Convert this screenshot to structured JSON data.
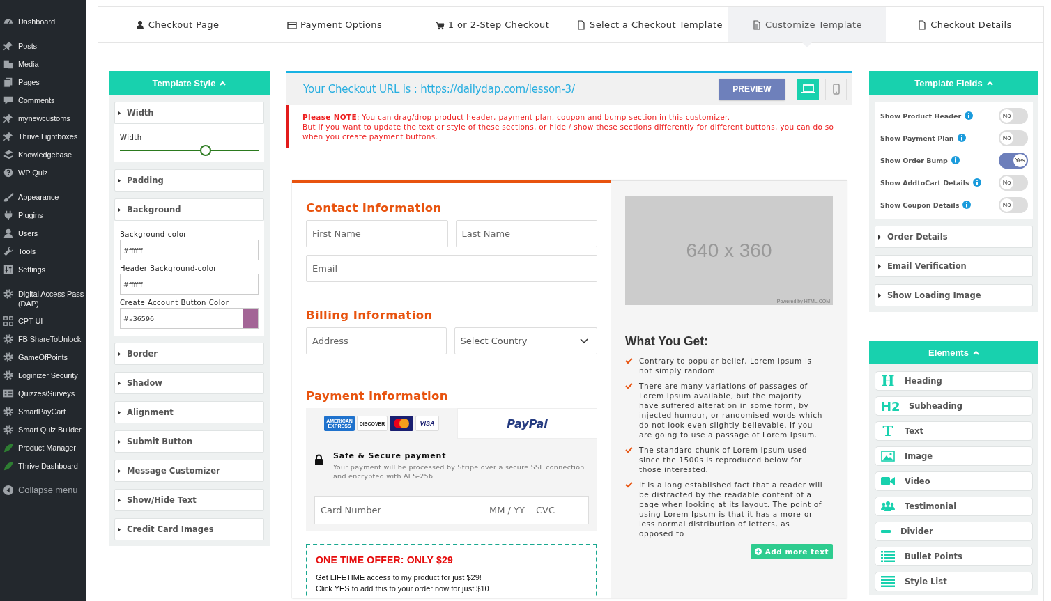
{
  "admin_menu": {
    "groups": [
      {
        "items": [
          {
            "label": "Dashboard"
          }
        ]
      },
      {
        "items": [
          {
            "label": "Posts"
          },
          {
            "label": "Media"
          },
          {
            "label": "Pages"
          },
          {
            "label": "Comments"
          },
          {
            "label": "mynewcustoms"
          },
          {
            "label": "Thrive Lightboxes"
          },
          {
            "label": "Knowledgebase"
          },
          {
            "label": "WP Quiz"
          }
        ]
      },
      {
        "items": [
          {
            "label": "Appearance"
          },
          {
            "label": "Plugins"
          },
          {
            "label": "Users"
          },
          {
            "label": "Tools"
          },
          {
            "label": "Settings"
          }
        ]
      },
      {
        "items": [
          {
            "label": "Digital Access Pass (DAP)"
          },
          {
            "label": "CPT UI"
          },
          {
            "label": "FB ShareToUnlock"
          },
          {
            "label": "GameOfPoints"
          },
          {
            "label": "Loginizer Security"
          },
          {
            "label": "Quizzes/Surveys"
          },
          {
            "label": "SmartPayCart"
          },
          {
            "label": "Smart Quiz Builder"
          },
          {
            "label": "Product Manager"
          },
          {
            "label": "Thrive Dashboard"
          }
        ]
      }
    ],
    "collapse": "Collapse menu"
  },
  "tabs": [
    {
      "label": "Checkout Page",
      "selected": false
    },
    {
      "label": "Payment Options",
      "selected": false
    },
    {
      "label": "1 or 2-Step Checkout",
      "selected": false
    },
    {
      "label": "Select a Checkout Template",
      "selected": false
    },
    {
      "label": "Customize Template",
      "selected": true
    },
    {
      "label": "Checkout Details",
      "selected": false
    }
  ],
  "template_style": {
    "title": "Template Style",
    "expanded": true,
    "sections": [
      {
        "label": "Width",
        "kind": "slider",
        "field_label": "Width",
        "level": 0.62
      },
      {
        "label": "Padding",
        "kind": "plain"
      },
      {
        "label": "Background",
        "kind": "colors",
        "fields": [
          {
            "label": "Background-color",
            "value": "#ffffff",
            "color": "#ffffff"
          },
          {
            "label": "Header Background-color",
            "value": "#ffffff",
            "color": "#ffffff"
          },
          {
            "label": "Create Account Button Color",
            "value": "#a36596",
            "color": "#a36596"
          }
        ]
      },
      {
        "label": "Border",
        "kind": "plain"
      },
      {
        "label": "Shadow",
        "kind": "plain"
      },
      {
        "label": "Alignment",
        "kind": "plain"
      },
      {
        "label": "Submit Button",
        "kind": "plain"
      },
      {
        "label": "Message Customizer",
        "kind": "plain"
      },
      {
        "label": "Show/Hide Text",
        "kind": "plain"
      },
      {
        "label": "Credit Card Images",
        "kind": "plain"
      }
    ]
  },
  "checkout_url": "Your Checkout URL is : https://dailydap.com/lesson-3/",
  "preview_button": "PREVIEW",
  "devices": [
    {
      "kind": "desktop",
      "selected": true
    },
    {
      "kind": "mobile",
      "selected": false
    }
  ],
  "note": [
    "**Please NOTE**: You can drag/drop product header, payment plan, coupon and bump section in this customizer.",
    "But if you want to update the text or style of these sections, or hide / show these sections differently for different buttons, you can do so when you create payment buttons."
  ],
  "form": {
    "contact": {
      "heading": "Contact Information",
      "first_name": {
        "placeholder": "First Name"
      },
      "last_name": {
        "placeholder": "Last Name"
      },
      "email": {
        "placeholder": "Email"
      }
    },
    "billing": {
      "heading": "Billing Information",
      "address": {
        "placeholder": "Address"
      },
      "country": {
        "placeholder": "Select Country"
      }
    },
    "payment": {
      "heading": "Payment Information",
      "cards": [
        {
          "kind": "amex",
          "label": "AMERICAN EXPRESS"
        },
        {
          "kind": "discover",
          "label": "DISCOVER"
        },
        {
          "kind": "mastercard"
        },
        {
          "kind": "visa",
          "label": "VISA"
        }
      ],
      "paypal": "PayPal",
      "secure_title": "Safe & Secure payment",
      "secure_text": "Your payment will be processed by Stripe over a secure SSL connection and encrypted with AES-256.",
      "card_number": {
        "placeholder": "Card Number"
      },
      "expiry": {
        "placeholder": "MM / YY"
      },
      "cvc": {
        "placeholder": "CVC"
      }
    },
    "offer": {
      "title": "ONE TIME OFFER: ONLY $29",
      "lines": [
        "Get LIFETIME access to my product for just $29!",
        "Click YES to add this to your order now for just $10"
      ]
    },
    "image_placeholder": {
      "size": "640 x 360",
      "credit": "Powered by HTML.COM"
    },
    "benefits_title": "What You Get:",
    "benefits": [
      "Contrary to popular belief, Lorem Ipsum is not simply random",
      "There are many variations of passages of Lorem Ipsum available, but the majority have suffered alteration in some form, by injected humour, or randomised words which do not look even slightly believable. If you are going to use a passage of Lorem Ipsum.",
      "The standard chunk of Lorem Ipsum used since the 1500s is reproduced below for those interested.",
      "It is a long established fact that a reader will be distracted by the readable content of a page when looking at its layout. The point of using Lorem Ipsum is that it has a more-or-less normal distribution of letters, as opposed to"
    ],
    "add_text_button": "Add more text"
  },
  "template_fields": {
    "title": "Template Fields",
    "expanded": true,
    "toggles": [
      {
        "label": "Show Product Header",
        "on": false,
        "state": "No"
      },
      {
        "label": "Show Payment Plan",
        "on": false,
        "state": "No"
      },
      {
        "label": "Show Order Bump",
        "on": true,
        "state": "Yes"
      },
      {
        "label": "Show AddtoCart Details",
        "on": false,
        "state": "No"
      },
      {
        "label": "Show Coupon Details",
        "on": false,
        "state": "No"
      }
    ],
    "sections": [
      "Order Details",
      "Email Verification",
      "Show Loading Image"
    ]
  },
  "elements": {
    "title": "Elements",
    "expanded": true,
    "items": [
      {
        "label": "Heading",
        "kind": "glyph",
        "glyph": "H"
      },
      {
        "label": "Subheading",
        "kind": "glyph",
        "glyph": "H2"
      },
      {
        "label": "Text",
        "kind": "glyph",
        "glyph": "T"
      },
      {
        "label": "Image",
        "kind": "image"
      },
      {
        "label": "Video",
        "kind": "video"
      },
      {
        "label": "Testimonial",
        "kind": "users"
      },
      {
        "label": "Divider",
        "kind": "divider"
      },
      {
        "label": "Bullet Points",
        "kind": "bullets"
      },
      {
        "label": "Style List",
        "kind": "lines"
      }
    ]
  }
}
